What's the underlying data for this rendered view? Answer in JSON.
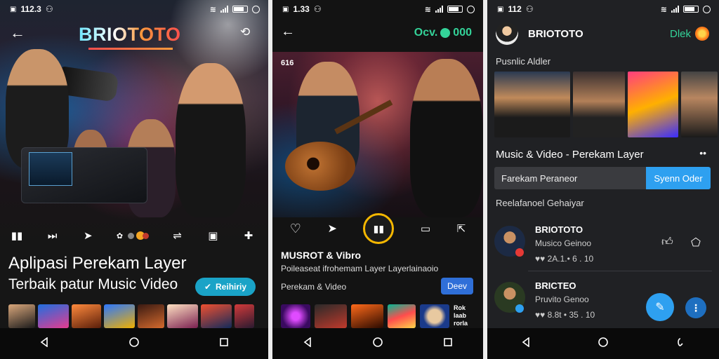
{
  "colors": {
    "accent_teal": "#1aa3c7",
    "accent_green": "#34d399",
    "accent_blue": "#2ea0f0",
    "dev_blue": "#2f6fd8"
  },
  "screen1": {
    "status": {
      "time": "112.3",
      "icons": [
        "photo-icon",
        "vibrate-icon",
        "signal-icon",
        "battery-icon",
        "sync-icon"
      ]
    },
    "brand": "BRIOTOTO",
    "headline_line1": "Aplipasi Perekam Layer",
    "headline_line2": "Terbaik patur Music Video",
    "cta_label": "Reihiriy",
    "controls": [
      "bookmark-icon",
      "skip-icon",
      "send-icon",
      "settings-icon",
      "share-icon",
      "folder-icon",
      "plus-icon"
    ]
  },
  "screen2": {
    "status": {
      "time": "1.33"
    },
    "top_cta": "Ocv.",
    "top_cta_number": "000",
    "hero_tag": "616",
    "title": "MUSROT & Vibro",
    "subtitle": "Poileaseat ifrohemam Layer Layerlainaoio",
    "subtitle2": "Perekam & Video",
    "dev_label": "Deev",
    "thumb_text": "Rok\nlaab\nrorla"
  },
  "screen3": {
    "status": {
      "time": "112"
    },
    "brand": "BRIOTOTO",
    "top_cta": "Dlek",
    "section1": "Pusnlic Aldler",
    "section2": "Music & Video - Perekam Layer",
    "more": "••",
    "search_placeholder": "Farekam Peraneor",
    "search_button": "Syenn Oder",
    "section3": "Reelafanoel Gehaiyar",
    "rows": [
      {
        "name": "BRIOTOTO",
        "sub": "Musico Geinoo",
        "meta": "♥♥ 2A.1.• 6 . 10"
      },
      {
        "name": "BRICTEO",
        "sub": "Pruvito Genoo",
        "meta": "♥♥ 8.8t • 35 . 10"
      }
    ]
  }
}
